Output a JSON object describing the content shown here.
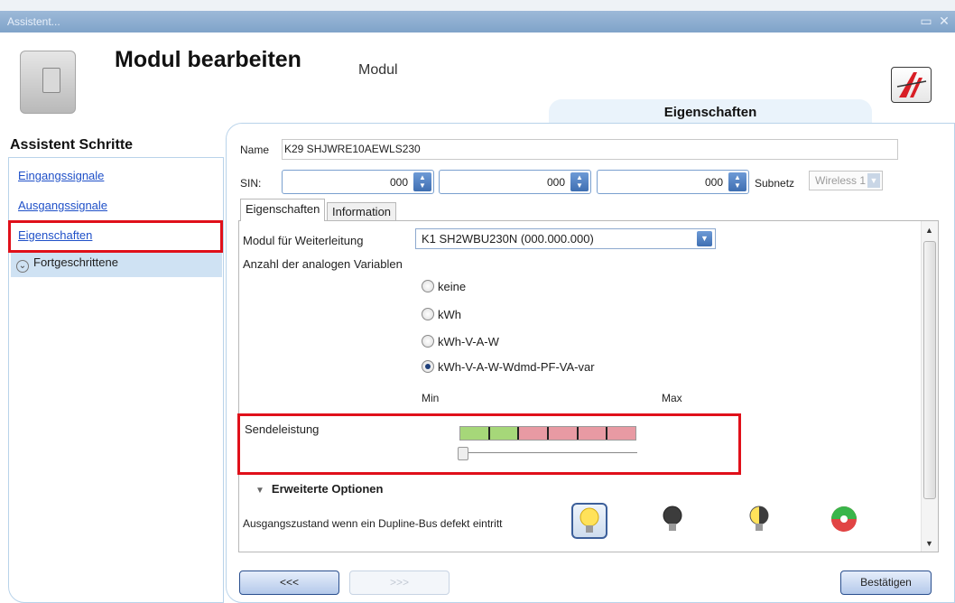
{
  "window": {
    "title": "Assistent..."
  },
  "header": {
    "title": "Modul bearbeiten",
    "subtitle": "Modul",
    "top_tab": "Eigenschaften"
  },
  "sidebar": {
    "heading": "Assistent Schritte",
    "items": [
      {
        "label": "Eingangssignale",
        "selected": false
      },
      {
        "label": "Ausgangssignale",
        "selected": false
      },
      {
        "label": "Eigenschaften",
        "selected": true
      }
    ],
    "expander": "Fortgeschrittene"
  },
  "form": {
    "name_label": "Name",
    "name_value": "K29 SHJWRE10AEWLS230",
    "sin_label": "SIN:",
    "sin_values": [
      "000",
      "000",
      "000"
    ],
    "subnet_label": "Subnetz",
    "subnet_value": "Wireless 1"
  },
  "tabs": [
    {
      "label": "Eigenschaften",
      "active": true
    },
    {
      "label": "Information",
      "active": false
    }
  ],
  "properties": {
    "forward_label": "Modul für Weiterleitung",
    "forward_value": "K1 SH2WBU230N (000.000.000)",
    "analog_label": "Anzahl der analogen Variablen",
    "analog_options": [
      {
        "label": "keine",
        "selected": false
      },
      {
        "label": "kWh",
        "selected": false
      },
      {
        "label": "kWh-V-A-W",
        "selected": false
      },
      {
        "label": "kWh-V-A-W-Wdmd-PF-VA-var",
        "selected": true
      }
    ],
    "min_label": "Min",
    "max_label": "Max",
    "send_label": "Sendeleistung",
    "send_level": 0,
    "meter_colors": [
      "#a6d779",
      "#a6d779",
      "#e89aa3",
      "#e89aa3",
      "#e89aa3",
      "#e89aa3"
    ],
    "advanced_header": "Erweiterte Optionen",
    "bus_label": "Ausgangszustand wenn ein Dupline-Bus defekt eintritt",
    "bus_icons": [
      "bulb-on-icon",
      "bulb-off-icon",
      "bulb-half-icon",
      "bulb-unchanged-icon"
    ]
  },
  "footer": {
    "back_label": "<<<",
    "next_label": ">>>",
    "confirm_label": "Bestätigen"
  }
}
